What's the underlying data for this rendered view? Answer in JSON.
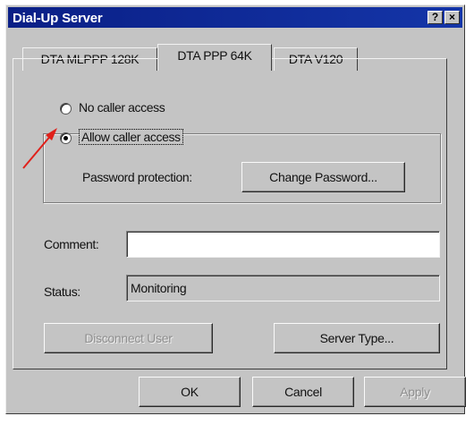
{
  "window": {
    "title": "Dial-Up Server",
    "help_glyph": "?",
    "close_glyph": "×"
  },
  "tabs": [
    {
      "label": "DTA MLPPP 128K",
      "active": false
    },
    {
      "label": "DTA PPP 64K",
      "active": true
    },
    {
      "label": "DTA V120",
      "active": false
    }
  ],
  "access": {
    "no_access_label": "No caller access",
    "allow_access_label": "Allow caller access",
    "selected": "allow"
  },
  "password": {
    "label": "Password protection:",
    "change_button": "Change Password..."
  },
  "comment": {
    "label": "Comment:",
    "value": ""
  },
  "status": {
    "label": "Status:",
    "value": "Monitoring"
  },
  "buttons": {
    "disconnect": "Disconnect User",
    "server_type": "Server Type...",
    "ok": "OK",
    "cancel": "Cancel",
    "apply": "Apply"
  },
  "annotation": {
    "arrow_color": "#e0201a"
  },
  "colors": {
    "title_bar": "#0a1f86",
    "face": "#c4c4c4"
  }
}
